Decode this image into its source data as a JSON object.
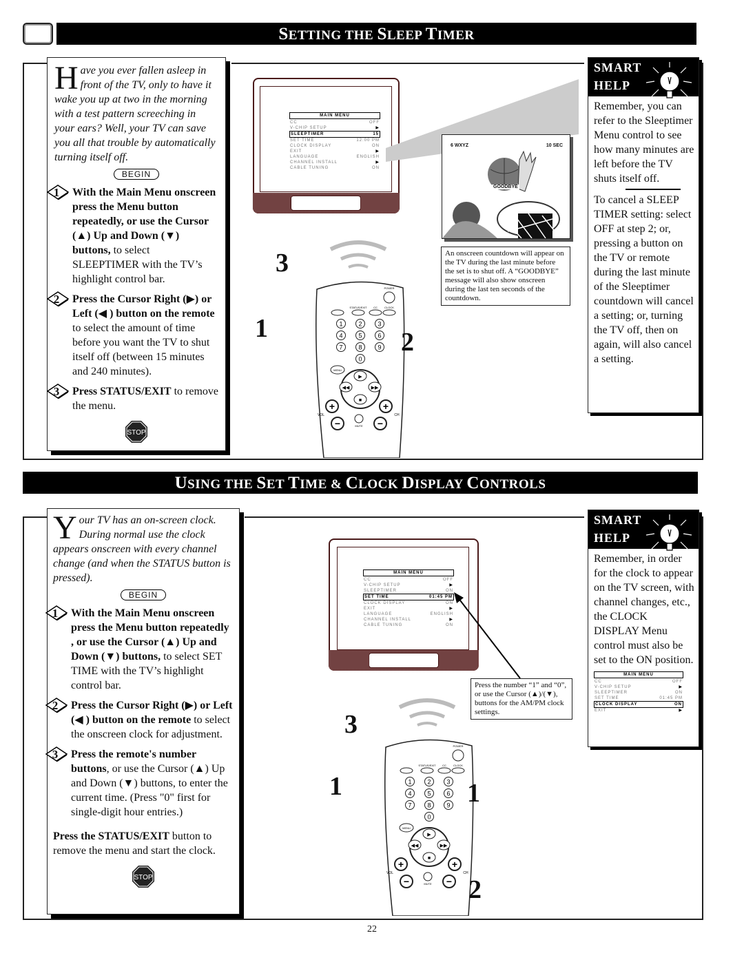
{
  "page_number": "22",
  "section1": {
    "title_parts": [
      {
        "cap": "S",
        "rest": "ETTING THE "
      },
      {
        "cap": "S",
        "rest": "LEEP "
      },
      {
        "cap": "T",
        "rest": "IMER"
      }
    ],
    "title": "Setting the Sleep Timer",
    "intro_dropcap": "H",
    "intro": "ave you ever fallen asleep in front of the TV, only to have it wake you up at two in the morning with a test pattern screeching in your ears?  Well, your TV can save you all that trouble by automatically turning itself off.",
    "begin_label": "BEGIN",
    "steps": [
      {
        "num": "1",
        "bold": "With the Main Menu onscreen press the Menu button repeatedly, or use the Cursor (▲) Up and Down (▼) buttons,",
        "text": " to select SLEEPTIMER with the TV’s highlight control bar."
      },
      {
        "num": "2",
        "bold": "Press the Cursor Right (▶) or Left (◀ ) button on the remote",
        "text": " to select the amount of time before you want the TV to shut itself off (between 15 minutes and 240 minutes)."
      },
      {
        "num": "3",
        "bold": "Press STATUS/EXIT",
        "text": " to remove the menu."
      }
    ],
    "stop_label": "STOP",
    "tv_menu": {
      "header": "MAIN MENU",
      "rows": [
        {
          "label": "CC",
          "value": "OFF",
          "highlight": false
        },
        {
          "label": "V-CHIP SETUP",
          "value": "▶",
          "highlight": false
        },
        {
          "label": "SLEEPTIMER",
          "value": "15",
          "highlight": true
        },
        {
          "label": "SET TIME",
          "value": "12:00 PM",
          "highlight": false
        },
        {
          "label": "CLOCK DISPLAY",
          "value": "ON",
          "highlight": false
        },
        {
          "label": "EXIT",
          "value": "▶",
          "highlight": false
        },
        {
          "label": "LANGUAGE",
          "value": "ENGLISH",
          "highlight": false
        },
        {
          "label": "CHANNEL INSTALL",
          "value": "▶",
          "highlight": false
        },
        {
          "label": "CABLE TUNING",
          "value": "ON",
          "highlight": false
        }
      ]
    },
    "countdown": {
      "channel": "6  WXYZ",
      "seconds": "10 SEC",
      "message": "GOODBYE"
    },
    "countdown_caption": "An onscreen countdown will appear on the TV during the last minute before the set is to shut off. A “GOODBYE” message will also show onscreen during the last ten seconds of the countdown.",
    "remote_cards": [
      "3",
      "1",
      "2"
    ],
    "smart_help": {
      "title1": "Smart",
      "title2": "Help",
      "para1": "Remember, you can refer to the Sleeptimer Menu control to see how many minutes are left before the TV shuts itself off.",
      "para2": "To cancel a SLEEP TIMER setting: select OFF at step 2; or, pressing a button on the TV or remote during the last minute of the Sleeptimer countdown will cancel a setting; or, turning the TV off, then on again, will also cancel a setting."
    }
  },
  "section2": {
    "title_parts": [
      {
        "cap": "U",
        "rest": "SING THE "
      },
      {
        "cap": "S",
        "rest": "ET "
      },
      {
        "cap": "T",
        "rest": "IME  & "
      },
      {
        "cap": "C",
        "rest": "LOCK "
      },
      {
        "cap": "D",
        "rest": "ISPLAY "
      },
      {
        "cap": "C",
        "rest": "ONTROLS"
      }
    ],
    "title": "Using the Set Time & Clock Display Controls",
    "intro_dropcap": "Y",
    "intro": "our TV has an on-screen clock. During normal use the clock appears onscreen with every channel change (and when the STATUS button is pressed).",
    "begin_label": "BEGIN",
    "steps": [
      {
        "num": "1",
        "bold": "With the Main Menu onscreen press the Menu button repeatedly , or use the Cursor (▲) Up and Down (▼) buttons,",
        "text": " to select SET TIME with the TV’s highlight control bar."
      },
      {
        "num": "2",
        "bold": "Press the Cursor Right (▶) or Left (◀ ) button on the remote",
        "text": " to select the onscreen clock for adjustment."
      },
      {
        "num": "3",
        "bold": "Press the remote's number buttons",
        "text": ", or use the Cursor (▲) Up and Down (▼) buttons, to enter the current time. (Press \"0\" first for single-digit hour entries.)"
      }
    ],
    "final_bold": "Press the STATUS/EXIT",
    "final_text": " button to remove the menu and start the clock.",
    "stop_label": "STOP",
    "tv_menu": {
      "header": "MAIN MENU",
      "rows": [
        {
          "label": "CC",
          "value": "OFF",
          "highlight": false
        },
        {
          "label": "V-CHIP SETUP",
          "value": "▶",
          "highlight": false
        },
        {
          "label": "SLEEPTIMER",
          "value": "ON",
          "highlight": false
        },
        {
          "label": "SET TIME",
          "value": "01:45 PM",
          "highlight": true
        },
        {
          "label": "CLOCK DISPLAY",
          "value": "ON",
          "highlight": false
        },
        {
          "label": "EXIT",
          "value": "▶",
          "highlight": false
        },
        {
          "label": "LANGUAGE",
          "value": "ENGLISH",
          "highlight": false
        },
        {
          "label": "CHANNEL INSTALL",
          "value": "▶",
          "highlight": false
        },
        {
          "label": "CABLE TUNING",
          "value": "ON",
          "highlight": false
        }
      ]
    },
    "clock_caption": "Press the number “1” and “0”, or use the Cursor (▲)/(▼), buttons for the AM/PM clock settings.",
    "remote_cards": [
      "3",
      "1",
      "1",
      "2"
    ],
    "smart_help": {
      "title1": "Smart",
      "title2": "Help",
      "para1": "Remember, in order for the clock to appear on the TV screen, with channel changes, etc.,  the CLOCK DISPLAY Menu control must also be set to the ON position.",
      "mini_menu": {
        "header": "MAIN MENU",
        "rows": [
          {
            "label": "CC",
            "value": "OFF",
            "highlight": false
          },
          {
            "label": "V-CHIP SETUP",
            "value": "▶",
            "highlight": false
          },
          {
            "label": "SLEEPTIMER",
            "value": "ON",
            "highlight": false
          },
          {
            "label": "SET TIME",
            "value": "01:45 PM",
            "highlight": false
          },
          {
            "label": "CLOCK DISPLAY",
            "value": "ON",
            "highlight": true
          },
          {
            "label": "EXIT",
            "value": "▶",
            "highlight": false
          }
        ]
      }
    }
  },
  "remote_labels": {
    "power": "POWER",
    "status": "STATUS/EXIT",
    "cc": "CC",
    "clock": "CLOCK",
    "menu": "MENU",
    "vol": "VOL",
    "ch": "CH",
    "mute": "MUTE",
    "digits": [
      "1",
      "2",
      "3",
      "4",
      "5",
      "6",
      "7",
      "8",
      "9",
      "0"
    ]
  }
}
